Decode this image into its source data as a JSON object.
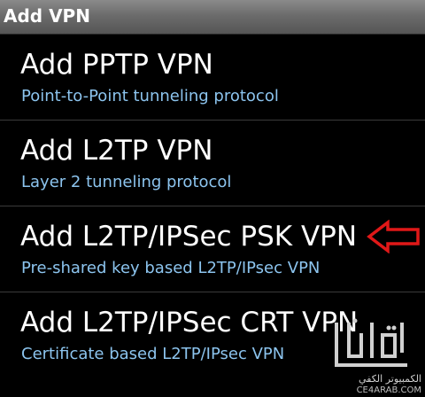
{
  "titlebar": {
    "title": "Add VPN"
  },
  "vpn_options": [
    {
      "title": "Add PPTP VPN",
      "subtitle": "Point-to-Point tunneling protocol"
    },
    {
      "title": "Add L2TP VPN",
      "subtitle": "Layer 2 tunneling protocol"
    },
    {
      "title": "Add L2TP/IPSec PSK VPN",
      "subtitle": "Pre-shared key based L2TP/IPsec VPN"
    },
    {
      "title": "Add L2TP/IPSec CRT VPN",
      "subtitle": "Certificate based L2TP/IPsec VPN"
    }
  ],
  "annotation": {
    "icon": "red-left-arrow-icon",
    "color": "#e01818",
    "points_to": "Add L2TP/IPSec PSK VPN"
  },
  "watermark": {
    "arabic_text": "الكمبيوتر الكفي",
    "url": "CE4ARAB.COM"
  },
  "colors": {
    "background": "#000000",
    "title_text": "#ffffff",
    "subtitle_text": "#8cc4ee",
    "divider": "#3a3a3a"
  }
}
